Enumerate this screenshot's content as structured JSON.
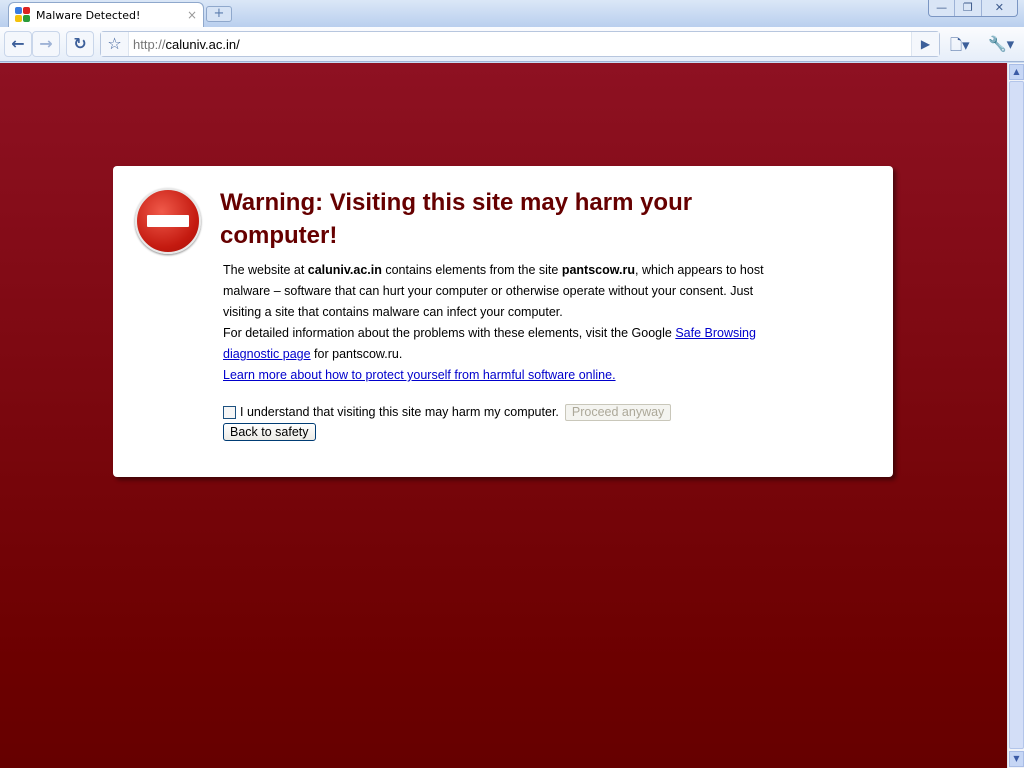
{
  "browser": {
    "tab_title": "Malware Detected!",
    "tab_close": "×",
    "new_tab": "+",
    "url_protocol": "http://",
    "url_host": "caluniv.ac.in/",
    "window_controls": {
      "minimize": "—",
      "restore": "❐",
      "close": "✕"
    },
    "icons": [
      "back-arrow",
      "forward-arrow",
      "reload",
      "star",
      "go-arrow",
      "page-menu",
      "wrench-menu"
    ]
  },
  "warning": {
    "headline": "Warning: Visiting this site may harm your computer!",
    "p1_a": "The website at ",
    "p1_site": "caluniv.ac.in",
    "p1_b": " contains elements from the site ",
    "p1_malware_site": "pantscow.ru",
    "p1_c": ", which appears to host malware – software that can hurt your computer or otherwise operate without your consent. Just visiting a site that contains malware can infect your computer.",
    "p2_a": "For detailed information about the problems with these elements, visit the Google ",
    "p2_link": "Safe Browsing diagnostic page",
    "p2_b": " for pantscow.ru.",
    "learn_more": "Learn more about how to protect yourself from harmful software online.",
    "checkbox_label": "I understand that visiting this site may harm my computer.",
    "checkbox_checked": false,
    "proceed_label": "Proceed anyway",
    "back_label": "Back to safety"
  },
  "colors": {
    "background": "#8e1122",
    "headline": "#660000",
    "link": "#0000cc"
  }
}
